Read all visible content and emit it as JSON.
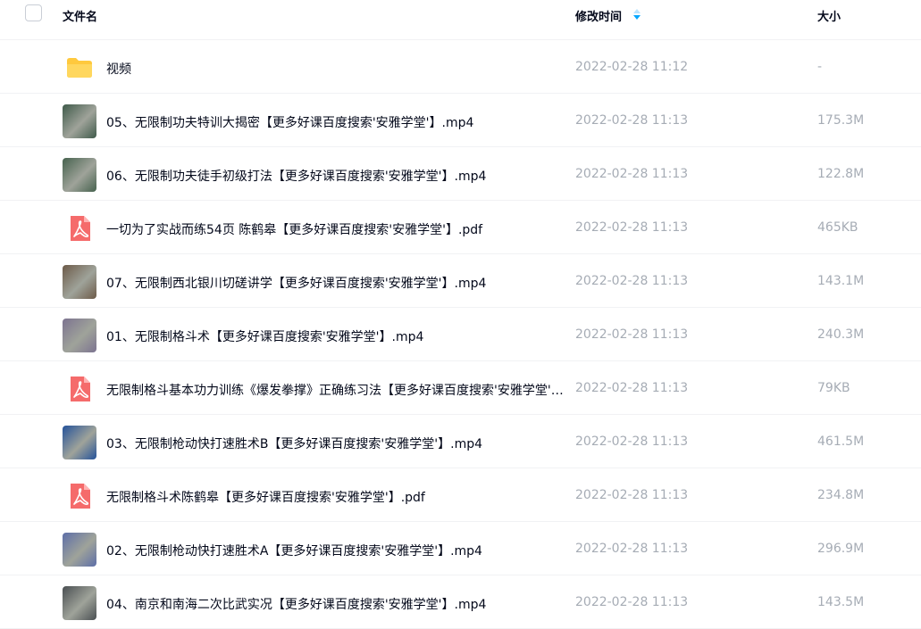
{
  "header": {
    "name_label": "文件名",
    "time_label": "修改时间",
    "size_label": "大小"
  },
  "files": [
    {
      "name": "视频",
      "time": "2022-02-28 11:12",
      "size": "-",
      "kind": "folder-icon"
    },
    {
      "name": "05、无限制功夫特训大揭密【更多好课百度搜索'安雅学堂'】.mp4",
      "time": "2022-02-28 11:13",
      "size": "175.3M",
      "kind": "video-thumbnail",
      "thumb_color": "#3f5a4a"
    },
    {
      "name": "06、无限制功夫徒手初级打法【更多好课百度搜索'安雅学堂'】.mp4",
      "time": "2022-02-28 11:13",
      "size": "122.8M",
      "kind": "video-thumbnail",
      "thumb_color": "#46624e"
    },
    {
      "name": "一切为了实战而练54页 陈鹤皋【更多好课百度搜索'安雅学堂'】.pdf",
      "time": "2022-02-28 11:13",
      "size": "465KB",
      "kind": "pdf-icon"
    },
    {
      "name": "07、无限制西北银川切磋讲学【更多好课百度搜索'安雅学堂'】.mp4",
      "time": "2022-02-28 11:13",
      "size": "143.1M",
      "kind": "video-thumbnail",
      "thumb_color": "#6c5a48"
    },
    {
      "name": "01、无限制格斗术【更多好课百度搜索'安雅学堂'】.mp4",
      "time": "2022-02-28 11:13",
      "size": "240.3M",
      "kind": "video-thumbnail",
      "thumb_color": "#7c7390"
    },
    {
      "name": "无限制格斗基本功力训练《爆发拳撑》正确练习法【更多好课百度搜索'安雅学堂'】.pdf",
      "time": "2022-02-28 11:13",
      "size": "79KB",
      "kind": "pdf-icon"
    },
    {
      "name": "03、无限制枪动快打速胜术B【更多好课百度搜索'安雅学堂'】.mp4",
      "time": "2022-02-28 11:13",
      "size": "461.5M",
      "kind": "video-thumbnail",
      "thumb_color": "#24529a"
    },
    {
      "name": "无限制格斗术陈鹤皋【更多好课百度搜索'安雅学堂'】.pdf",
      "time": "2022-02-28 11:13",
      "size": "234.8M",
      "kind": "pdf-icon"
    },
    {
      "name": "02、无限制枪动快打速胜术A【更多好课百度搜索'安雅学堂'】.mp4",
      "time": "2022-02-28 11:13",
      "size": "296.9M",
      "kind": "video-thumbnail",
      "thumb_color": "#5d6ea8"
    },
    {
      "name": "04、南京和南海二次比武实况【更多好课百度搜索'安雅学堂'】.mp4",
      "time": "2022-02-28 11:13",
      "size": "143.5M",
      "kind": "video-thumbnail",
      "thumb_color": "#4a4f52"
    }
  ],
  "colors": {
    "folder": "#ffc93d",
    "pdf": "#f56b6b",
    "sort_accent": "#06a7ff"
  }
}
